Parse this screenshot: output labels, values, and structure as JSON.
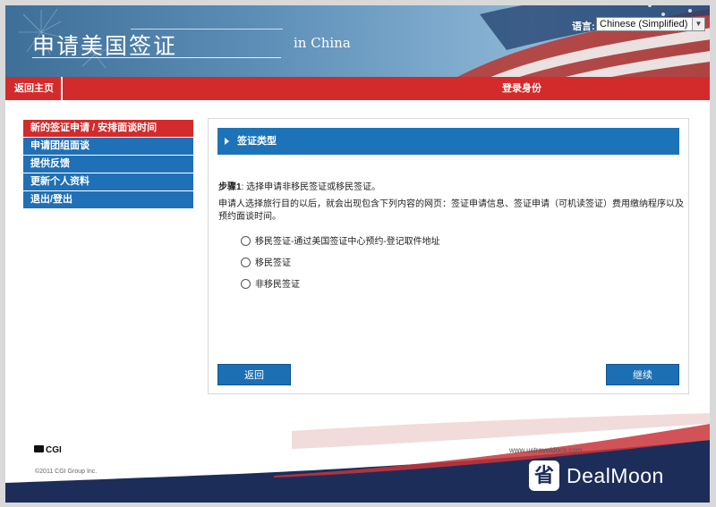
{
  "header": {
    "site_title": "申请美国签证",
    "subtitle": "in China",
    "language_label": "语言:",
    "language_value": "Chinese (Simplified)"
  },
  "nav": {
    "home_label": "返回主页",
    "login_label": "登录身份"
  },
  "sidebar": {
    "items": [
      {
        "label": "新的签证申请 / 安排面谈时间",
        "active": true
      },
      {
        "label": "申请团组面谈",
        "active": false
      },
      {
        "label": "提供反馈",
        "active": false
      },
      {
        "label": "更新个人资料",
        "active": false
      },
      {
        "label": "退出/登出",
        "active": false
      }
    ]
  },
  "panel": {
    "title": "签证类型",
    "step_prefix": "步骤1",
    "step_text": ": 选择申请非移民签证或移民签证。",
    "description": "申请人选择旅行目的以后，就会出现包含下列内容的网页：签证申请信息、签证申请（可机读签证）费用缴纳程序以及预约面谈时间。",
    "options": [
      {
        "label": "移民签证-通过美国签证中心预约-登记取件地址"
      },
      {
        "label": "移民签证"
      },
      {
        "label": "非移民签证"
      }
    ],
    "back_label": "返回",
    "next_label": "继续"
  },
  "footer": {
    "logo_text": "CGI",
    "copyright": "©2011 CGI Group Inc.",
    "url": "www.ustraveldocs.com",
    "watermark_icon": "省",
    "watermark_text": "DealMoon"
  },
  "colors": {
    "nav_red": "#d32b2b",
    "accent_blue": "#1c73b8",
    "footer_navy": "#1d2d5a"
  }
}
